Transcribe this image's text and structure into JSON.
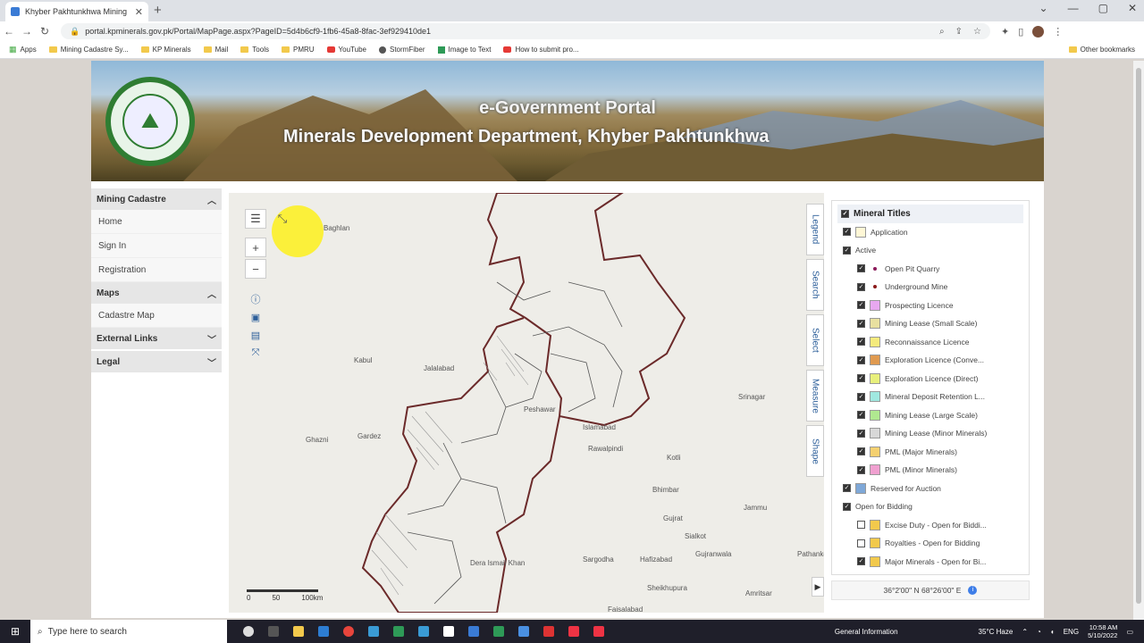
{
  "browser": {
    "tab_title": "Khyber Pakhtunkhwa Mining Ca",
    "url": "portal.kpminerals.gov.pk/Portal/MapPage.aspx?PageID=5d4b6cf9-1fb6-45a8-8fac-3ef929410de1",
    "bookmarks": [
      {
        "label": "Apps",
        "icon": "grid"
      },
      {
        "label": "Mining Cadastre Sy...",
        "icon": "folder"
      },
      {
        "label": "KP Minerals",
        "icon": "folder"
      },
      {
        "label": "Mail",
        "icon": "folder"
      },
      {
        "label": "Tools",
        "icon": "folder"
      },
      {
        "label": "PMRU",
        "icon": "folder"
      },
      {
        "label": "YouTube",
        "icon": "youtube"
      },
      {
        "label": "StormFiber",
        "icon": "globe"
      },
      {
        "label": "Image to Text",
        "icon": "image"
      },
      {
        "label": "How to submit pro...",
        "icon": "youtube"
      }
    ],
    "other_bookmarks": "Other bookmarks"
  },
  "banner": {
    "title_line1": "e-Government Portal",
    "title_line2": "Minerals Development Department, Khyber Pakhtunkhwa"
  },
  "sidebar": {
    "sections": [
      {
        "header": "Mining Cadastre",
        "expanded": true,
        "items": [
          "Home",
          "Sign In",
          "Registration"
        ]
      },
      {
        "header": "Maps",
        "expanded": true,
        "items": [
          "Cadastre Map"
        ]
      },
      {
        "header": "External Links",
        "expanded": false,
        "items": []
      },
      {
        "header": "Legal",
        "expanded": false,
        "items": []
      }
    ]
  },
  "map": {
    "side_tabs": [
      "Legend",
      "Search",
      "Select",
      "Measure",
      "Shape"
    ],
    "cities": [
      "Baghlan",
      "Kabul",
      "Jalalabad",
      "Ghazni",
      "Gardez",
      "Peshawar",
      "Islamabad",
      "Rawalpindi",
      "Kotli",
      "Srinagar",
      "Bhimbar",
      "Jammu",
      "Gujrat",
      "Sialkot",
      "Sargodha",
      "Hafizabad",
      "Gujranwala",
      "Pathankot",
      "Sheikhupura",
      "Amritsar",
      "Faisalabad",
      "Dera Ismail Khan"
    ],
    "scale_labels": [
      "0",
      "50",
      "100km"
    ],
    "coordinates": "36°2'00\" N 68°26'00\" E"
  },
  "legend": {
    "title": "Mineral Titles",
    "items": [
      {
        "label": "Application",
        "indent": 1,
        "checked": true,
        "swatch": "#fff7d6",
        "type": "swatch"
      },
      {
        "label": "Active",
        "indent": 1,
        "checked": true,
        "type": "group"
      },
      {
        "label": "Open Pit Quarry",
        "indent": 2,
        "checked": true,
        "swatch": "#8b1a5a",
        "type": "dot"
      },
      {
        "label": "Underground Mine",
        "indent": 2,
        "checked": true,
        "swatch": "#8b1a1a",
        "type": "dot"
      },
      {
        "label": "Prospecting Licence",
        "indent": 2,
        "checked": true,
        "swatch": "#e8a8f0",
        "type": "swatch"
      },
      {
        "label": "Mining Lease (Small Scale)",
        "indent": 2,
        "checked": true,
        "swatch": "#e8e0a0",
        "type": "swatch"
      },
      {
        "label": "Reconnaissance Licence",
        "indent": 2,
        "checked": true,
        "swatch": "#f4ea7c",
        "type": "swatch"
      },
      {
        "label": "Exploration Licence (Conve...",
        "indent": 2,
        "checked": true,
        "swatch": "#e09a50",
        "type": "swatch"
      },
      {
        "label": "Exploration Licence (Direct)",
        "indent": 2,
        "checked": true,
        "swatch": "#e8f07c",
        "type": "swatch"
      },
      {
        "label": "Mineral Deposit Retention L...",
        "indent": 2,
        "checked": true,
        "swatch": "#a0e8e0",
        "type": "swatch"
      },
      {
        "label": "Mining Lease (Large Scale)",
        "indent": 2,
        "checked": true,
        "swatch": "#b0e890",
        "type": "swatch"
      },
      {
        "label": "Mining Lease (Minor Minerals)",
        "indent": 2,
        "checked": true,
        "swatch": "#d8d8d8",
        "type": "swatch"
      },
      {
        "label": "PML (Major Minerals)",
        "indent": 2,
        "checked": true,
        "swatch": "#f4d070",
        "type": "swatch"
      },
      {
        "label": "PML (Minor Minerals)",
        "indent": 2,
        "checked": true,
        "swatch": "#f0a0d0",
        "type": "swatch"
      },
      {
        "label": "Reserved for Auction",
        "indent": 1,
        "checked": true,
        "swatch": "#7fa8d8",
        "type": "swatch"
      },
      {
        "label": "Open for Bidding",
        "indent": 1,
        "checked": true,
        "type": "group"
      },
      {
        "label": "Excise Duty - Open for Biddi...",
        "indent": 2,
        "checked": false,
        "swatch": "#f2c94c",
        "type": "swatch"
      },
      {
        "label": "Royalties - Open for Bidding",
        "indent": 2,
        "checked": false,
        "swatch": "#f2c94c",
        "type": "swatch"
      },
      {
        "label": "Major Minerals - Open for Bi...",
        "indent": 2,
        "checked": true,
        "swatch": "#f2c94c",
        "type": "swatch"
      }
    ]
  },
  "taskbar": {
    "search_placeholder": "Type here to search",
    "weather": "35°C Haze",
    "status": "General Information",
    "lang": "ENG",
    "time": "10:58 AM",
    "date": "5/10/2022"
  }
}
